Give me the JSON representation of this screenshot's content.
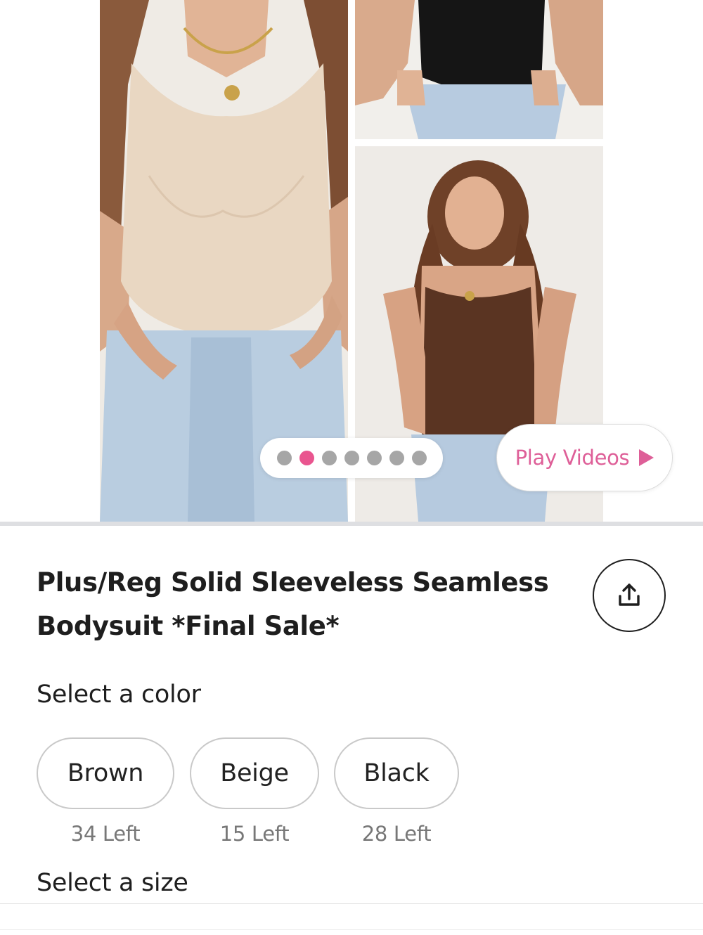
{
  "gallery": {
    "active_index": 1,
    "dots": [
      "",
      "",
      "",
      "",
      "",
      "",
      ""
    ],
    "play_videos_label": "Play Videos"
  },
  "product": {
    "title_line1": "Plus/Reg Solid Sleeveless Seamless",
    "title_line2": "Bodysuit *Final Sale*"
  },
  "color_section": {
    "label": "Select a color",
    "options": [
      {
        "name": "Brown",
        "stock": "34 Left"
      },
      {
        "name": "Beige",
        "stock": "15 Left"
      },
      {
        "name": "Black",
        "stock": "28 Left"
      }
    ]
  },
  "size_section": {
    "label": "Select a size"
  },
  "colors": {
    "accent_pink": "#e9558f",
    "play_text": "#de5f98",
    "divider": "#dedfe2"
  }
}
